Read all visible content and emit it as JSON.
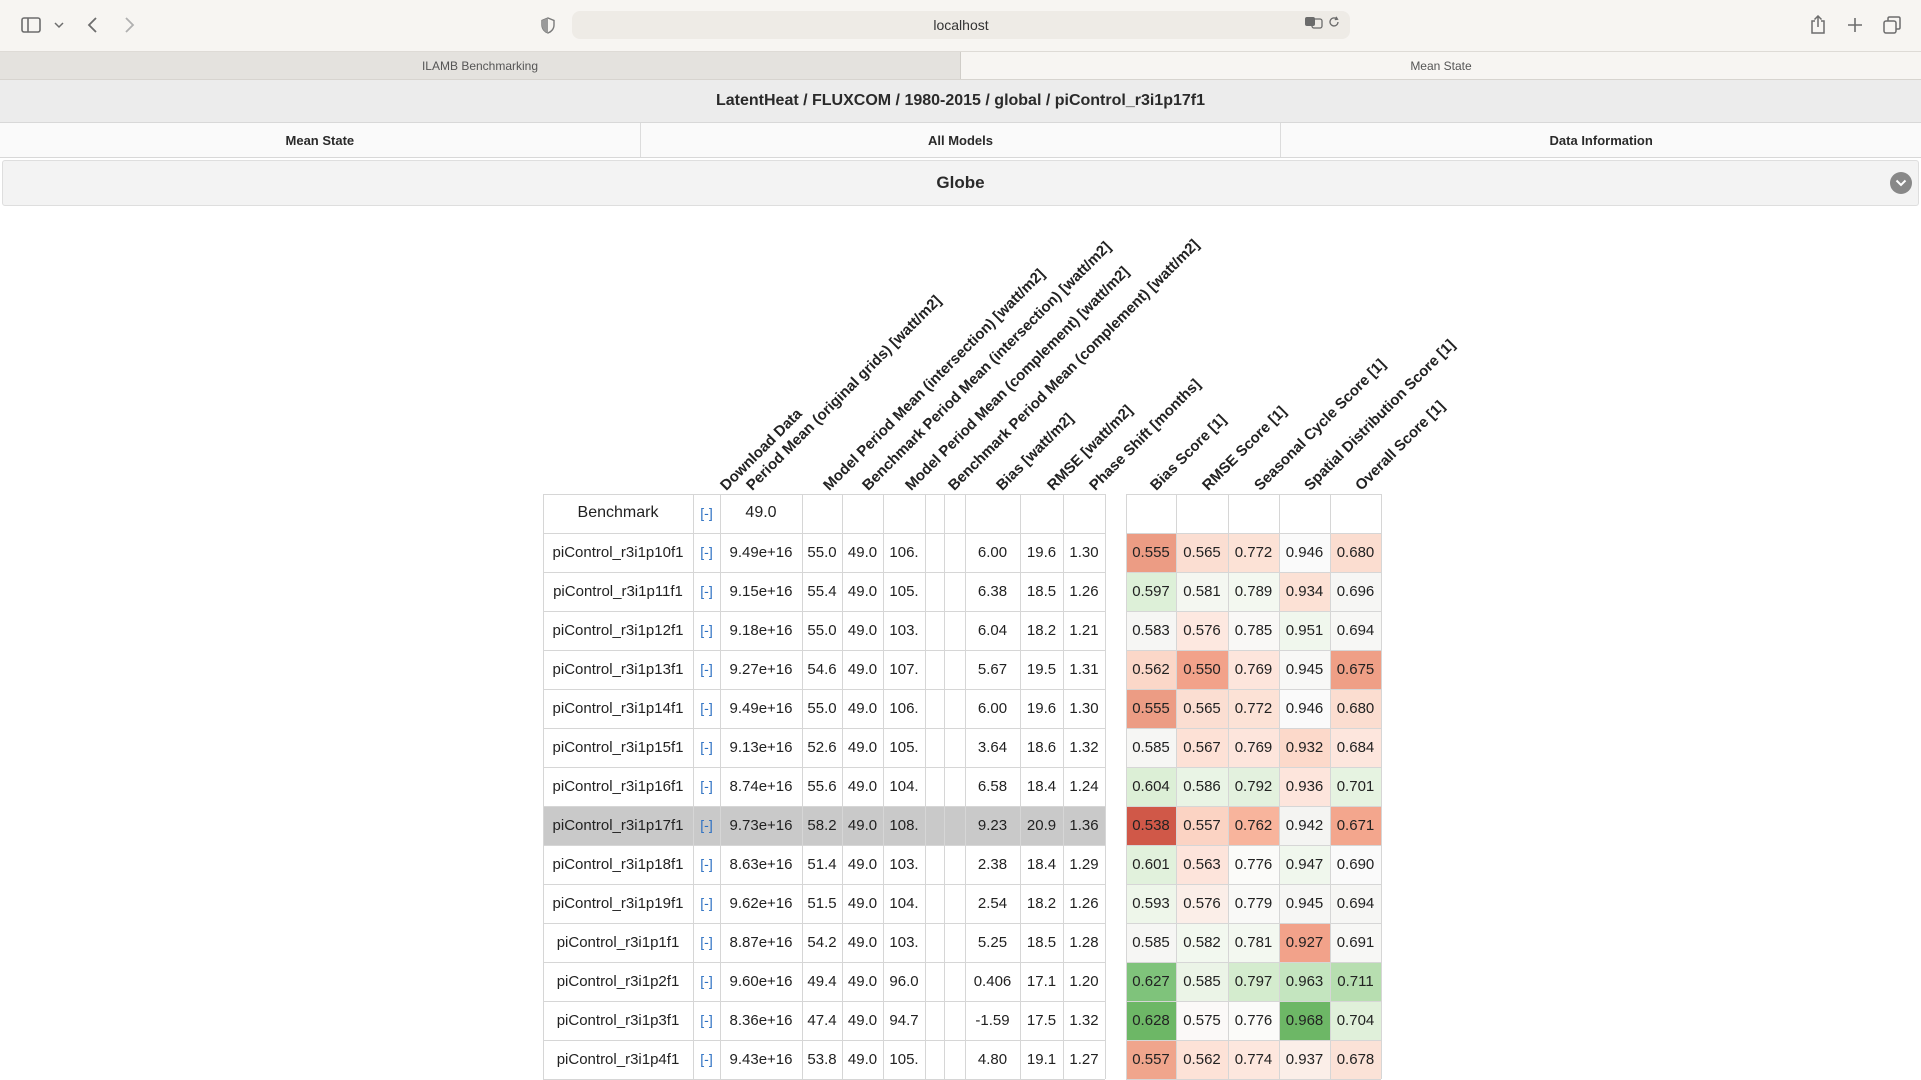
{
  "browser": {
    "url": "localhost",
    "tabs": [
      {
        "label": "ILAMB Benchmarking",
        "active": false
      },
      {
        "label": "Mean State",
        "active": true
      }
    ]
  },
  "page": {
    "title": "LatentHeat / FLUXCOM / 1980-2015 / global / piControl_r3i1p17f1",
    "nav": [
      "Mean State",
      "All Models",
      "Data Information"
    ],
    "section": "Globe"
  },
  "table": {
    "headers": [
      "Download Data",
      "Period Mean (original grids) [watt/m2]",
      "Model Period Mean (intersection) [watt/m2]",
      "Benchmark Period Mean (intersection) [watt/m2]",
      "Model Period Mean (complement) [watt/m2]",
      "Benchmark Period Mean (complement) [watt/m2]",
      "Bias [watt/m2]",
      "RMSE [watt/m2]",
      "Phase Shift [months]",
      "Bias Score [1]",
      "RMSE Score [1]",
      "Seasonal Cycle Score [1]",
      "Spatial Distribution Score [1]",
      "Overall Score [1]"
    ],
    "download_glyph": "[-]",
    "benchmark": {
      "name": "Benchmark",
      "period_mean": "49.0"
    },
    "highlight_row": "piControl_r3i1p17f1",
    "rows": [
      {
        "name": "piControl_r3i1p10f1",
        "v": [
          "9.49e+16",
          "55.0",
          "49.0",
          "106.",
          "",
          "6.00",
          "19.6",
          "1.30"
        ],
        "s": [
          "0.555",
          "0.565",
          "0.772",
          "0.946",
          "0.680"
        ]
      },
      {
        "name": "piControl_r3i1p11f1",
        "v": [
          "9.15e+16",
          "55.4",
          "49.0",
          "105.",
          "",
          "6.38",
          "18.5",
          "1.26"
        ],
        "s": [
          "0.597",
          "0.581",
          "0.789",
          "0.934",
          "0.696"
        ]
      },
      {
        "name": "piControl_r3i1p12f1",
        "v": [
          "9.18e+16",
          "55.0",
          "49.0",
          "103.",
          "",
          "6.04",
          "18.2",
          "1.21"
        ],
        "s": [
          "0.583",
          "0.576",
          "0.785",
          "0.951",
          "0.694"
        ]
      },
      {
        "name": "piControl_r3i1p13f1",
        "v": [
          "9.27e+16",
          "54.6",
          "49.0",
          "107.",
          "",
          "5.67",
          "19.5",
          "1.31"
        ],
        "s": [
          "0.562",
          "0.550",
          "0.769",
          "0.945",
          "0.675"
        ]
      },
      {
        "name": "piControl_r3i1p14f1",
        "v": [
          "9.49e+16",
          "55.0",
          "49.0",
          "106.",
          "",
          "6.00",
          "19.6",
          "1.30"
        ],
        "s": [
          "0.555",
          "0.565",
          "0.772",
          "0.946",
          "0.680"
        ]
      },
      {
        "name": "piControl_r3i1p15f1",
        "v": [
          "9.13e+16",
          "52.6",
          "49.0",
          "105.",
          "",
          "3.64",
          "18.6",
          "1.32"
        ],
        "s": [
          "0.585",
          "0.567",
          "0.769",
          "0.932",
          "0.684"
        ]
      },
      {
        "name": "piControl_r3i1p16f1",
        "v": [
          "8.74e+16",
          "55.6",
          "49.0",
          "104.",
          "",
          "6.58",
          "18.4",
          "1.24"
        ],
        "s": [
          "0.604",
          "0.586",
          "0.792",
          "0.936",
          "0.701"
        ]
      },
      {
        "name": "piControl_r3i1p17f1",
        "v": [
          "9.73e+16",
          "58.2",
          "49.0",
          "108.",
          "",
          "9.23",
          "20.9",
          "1.36"
        ],
        "s": [
          "0.538",
          "0.557",
          "0.762",
          "0.942",
          "0.671"
        ]
      },
      {
        "name": "piControl_r3i1p18f1",
        "v": [
          "8.63e+16",
          "51.4",
          "49.0",
          "103.",
          "",
          "2.38",
          "18.4",
          "1.29"
        ],
        "s": [
          "0.601",
          "0.563",
          "0.776",
          "0.947",
          "0.690"
        ]
      },
      {
        "name": "piControl_r3i1p19f1",
        "v": [
          "9.62e+16",
          "51.5",
          "49.0",
          "104.",
          "",
          "2.54",
          "18.2",
          "1.26"
        ],
        "s": [
          "0.593",
          "0.576",
          "0.779",
          "0.945",
          "0.694"
        ]
      },
      {
        "name": "piControl_r3i1p1f1",
        "v": [
          "8.87e+16",
          "54.2",
          "49.0",
          "103.",
          "",
          "5.25",
          "18.5",
          "1.28"
        ],
        "s": [
          "0.585",
          "0.582",
          "0.781",
          "0.927",
          "0.691"
        ]
      },
      {
        "name": "piControl_r3i1p2f1",
        "v": [
          "9.60e+16",
          "49.4",
          "49.0",
          "96.0",
          "",
          "0.406",
          "17.1",
          "1.20"
        ],
        "s": [
          "0.627",
          "0.585",
          "0.797",
          "0.963",
          "0.711"
        ]
      },
      {
        "name": "piControl_r3i1p3f1",
        "v": [
          "8.36e+16",
          "47.4",
          "49.0",
          "94.7",
          "",
          "-1.59",
          "17.5",
          "1.32"
        ],
        "s": [
          "0.628",
          "0.575",
          "0.776",
          "0.968",
          "0.704"
        ]
      },
      {
        "name": "piControl_r3i1p4f1",
        "v": [
          "9.43e+16",
          "53.8",
          "49.0",
          "105.",
          "",
          "4.80",
          "19.1",
          "1.27"
        ],
        "s": [
          "0.557",
          "0.562",
          "0.774",
          "0.937",
          "0.678"
        ]
      }
    ],
    "score_colors": [
      [
        "#ec9c84",
        "#fbded2",
        "#fce2d6",
        "#fafafa",
        "#fbddd0"
      ],
      [
        "#ddf0d8",
        "#f4f7f1",
        "#f3f8f0",
        "#fce1d5",
        "#f6f6f4"
      ],
      [
        "#f6f6f4",
        "#fde8e0",
        "#f9f8f6",
        "#f0f7ed",
        "#f7f7f5"
      ],
      [
        "#fbd7c8",
        "#f2a28a",
        "#fde5dc",
        "#f8f8f6",
        "#ef9f86"
      ],
      [
        "#ec9c84",
        "#fbded2",
        "#fce2d6",
        "#fafafa",
        "#fbddd0"
      ],
      [
        "#f6f6f4",
        "#fde1d6",
        "#fde5dc",
        "#fcd9ca",
        "#fde6dd"
      ],
      [
        "#dcefd6",
        "#e9f4e5",
        "#e3f1de",
        "#fde5dc",
        "#e6f3e1"
      ],
      [
        "#d05848",
        "#fbd3c3",
        "#f8b49c",
        "#f4f4f2",
        "#f3a68d"
      ],
      [
        "#e1f1dc",
        "#fde4db",
        "#fbfbf9",
        "#f0f7ed",
        "#fafafa"
      ],
      [
        "#eef6ea",
        "#fbeee8",
        "#f9f9f7",
        "#f6f6f4",
        "#f6f6f4"
      ],
      [
        "#f6f6f4",
        "#f2f8ef",
        "#f3f8f0",
        "#f2a28a",
        "#f7f7f5"
      ],
      [
        "#7fc37b",
        "#ebf4e7",
        "#d4ecce",
        "#c4e5bf",
        "#b7deb0"
      ],
      [
        "#6db766",
        "#fbf9f8",
        "#fbfbf9",
        "#6db766",
        "#e0f0da"
      ],
      [
        "#f0a58c",
        "#fde2d7",
        "#fde7de",
        "#fbeee8",
        "#fbe2d7"
      ]
    ]
  }
}
